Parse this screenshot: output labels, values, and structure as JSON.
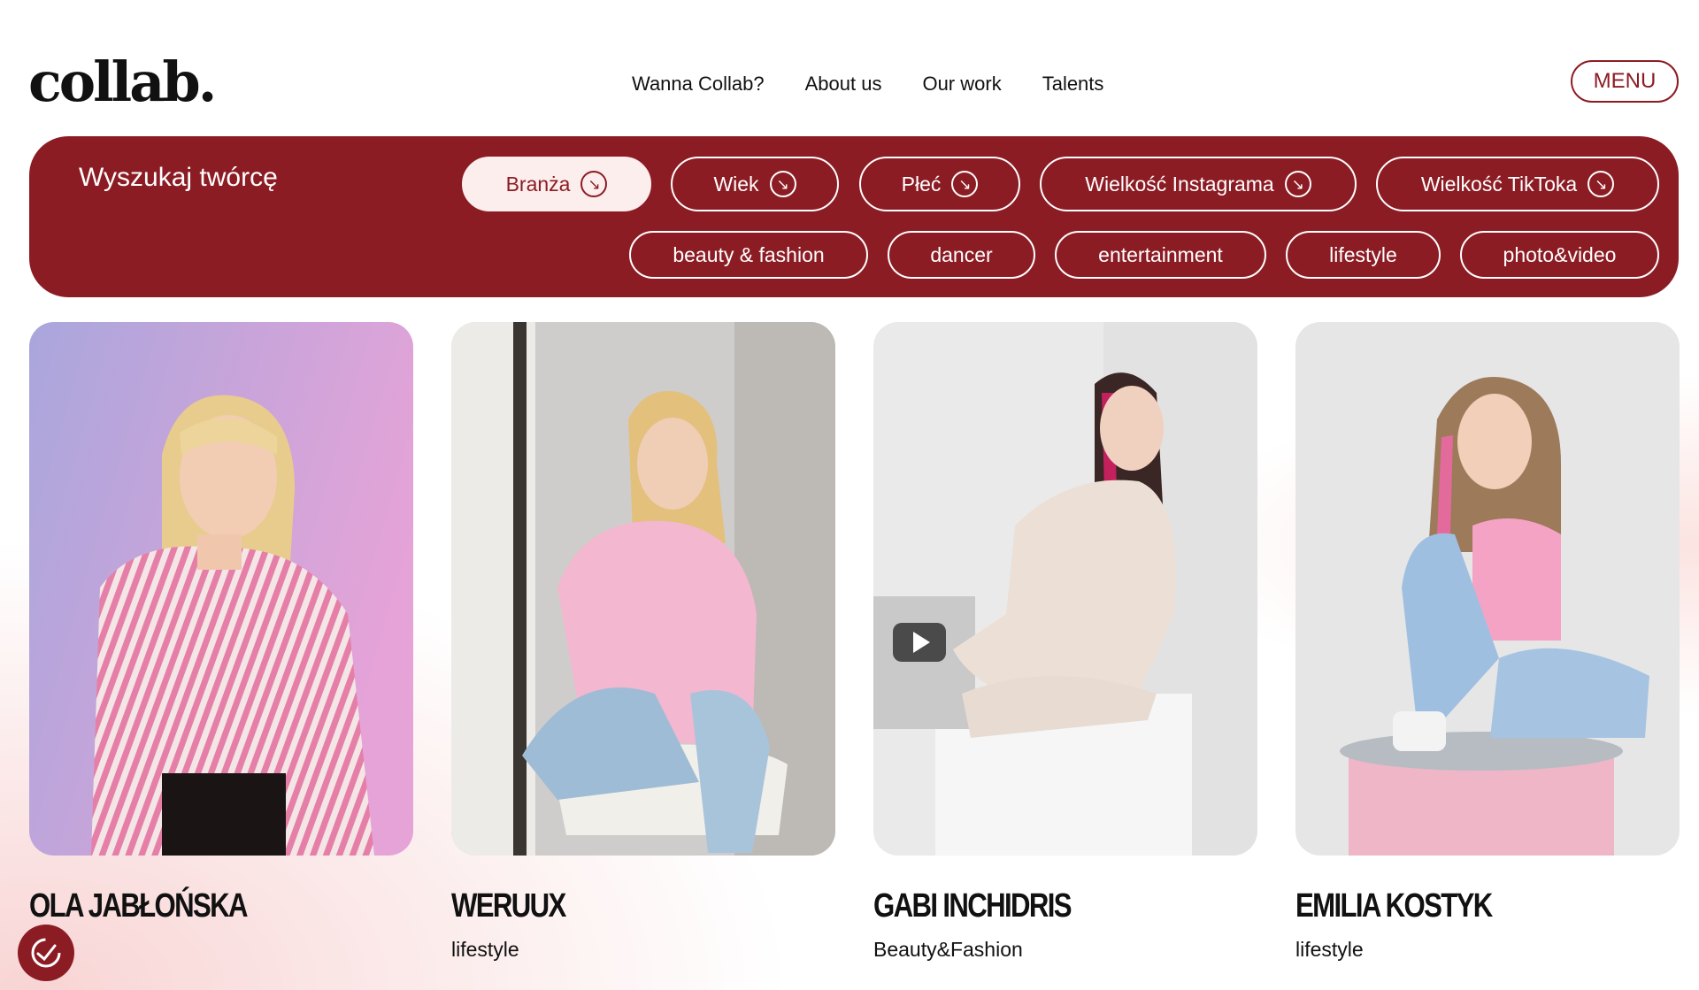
{
  "brand": {
    "logo_text": "collab."
  },
  "nav": {
    "items": [
      "Wanna Collab?",
      "About us",
      "Our work",
      "Talents"
    ]
  },
  "menu_label": "MENU",
  "search": {
    "title": "Wyszukaj twórcę",
    "filters": [
      "Branża",
      "Wiek",
      "Płeć",
      "Wielkość Instagrama",
      "Wielkość TikToka"
    ],
    "active_filter": "Branża",
    "options": [
      "beauty & fashion",
      "dancer",
      "entertainment",
      "lifestyle",
      "photo&video"
    ]
  },
  "talents": [
    {
      "name": "OLA JABŁOŃSKA",
      "category": ""
    },
    {
      "name": "WERUUX",
      "category": "lifestyle"
    },
    {
      "name": "GABI INCHIDRIS",
      "category": "Beauty&Fashion"
    },
    {
      "name": "EMILIA KOSTYK",
      "category": "lifestyle"
    }
  ],
  "colors": {
    "brand": "#8c1c24",
    "active_pill_bg": "#fbeeec"
  },
  "icons": {
    "filter_arrow": "arrow-down-right-icon",
    "accessibility": "accessibility-check-icon"
  }
}
